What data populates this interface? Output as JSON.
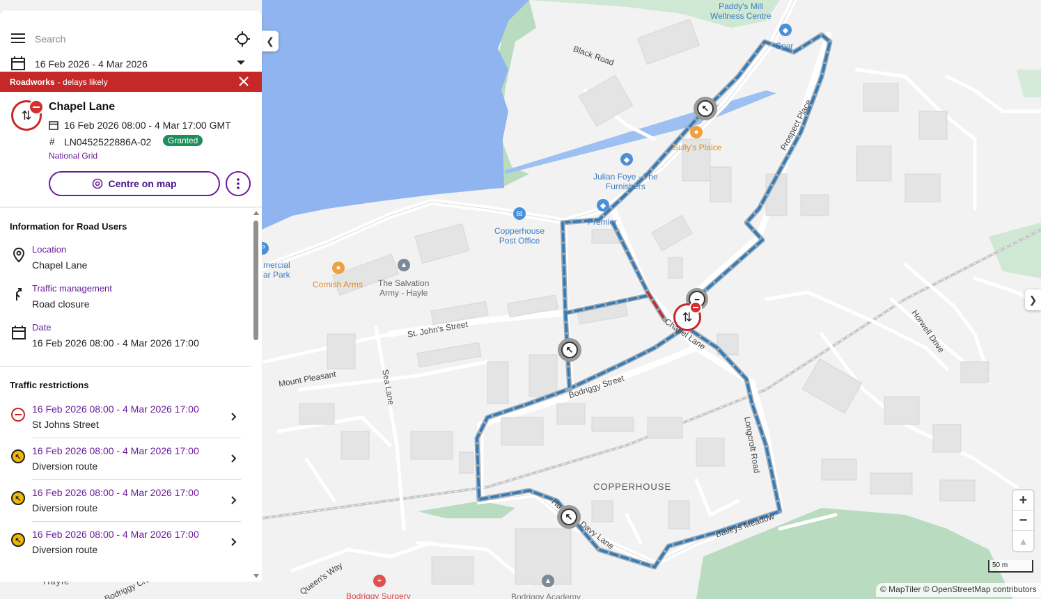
{
  "search": {
    "placeholder": "Search"
  },
  "date_filter": {
    "range": "16 Feb 2026 - 4 Mar 2026"
  },
  "alert": {
    "title": "Roadworks",
    "subtitle": "- delays likely"
  },
  "works": {
    "title": "Chapel Lane",
    "dates": "16 Feb 2026 08:00 - 4 Mar 17:00 GMT",
    "reference": "LN0452522886A-02",
    "status": "Granted",
    "organisation": "National Grid",
    "centre_button": "Centre on map"
  },
  "info": {
    "heading": "Information for Road Users",
    "items": [
      {
        "label": "Location",
        "value": "Chapel Lane",
        "icon": "location-pin-icon"
      },
      {
        "label": "Traffic management",
        "value": "Road closure",
        "icon": "traffic-management-icon"
      },
      {
        "label": "Date",
        "value": "16 Feb 2026 08:00 - 4 Mar 2026 17:00",
        "icon": "calendar-icon"
      }
    ]
  },
  "restrictions": {
    "heading": "Traffic restrictions",
    "items": [
      {
        "dates": "16 Feb 2026 08:00 - 4 Mar 2026 17:00",
        "name": "St Johns Street",
        "type": "closure"
      },
      {
        "dates": "16 Feb 2026 08:00 - 4 Mar 2026 17:00",
        "name": "Diversion route",
        "type": "diversion"
      },
      {
        "dates": "16 Feb 2026 08:00 - 4 Mar 2026 17:00",
        "name": "Diversion route",
        "type": "diversion"
      },
      {
        "dates": "16 Feb 2026 08:00 - 4 Mar 2026 17:00",
        "name": "Diversion route",
        "type": "diversion"
      }
    ]
  },
  "map": {
    "labels": {
      "paddys_mill": "Paddy's Mill\nWellness Centre",
      "spar": "Spar",
      "black_road": "Black Road",
      "sullys": "Sully's Plaice",
      "julian_foye": "Julian Foye - The\nFurnishers",
      "premier": "Premier",
      "post_office": "Copperhouse\nPost Office",
      "prospect_place": "Prospect Place",
      "commercial_car_park": "mercial\nar Park",
      "cornish_arms": "Cornish Arms",
      "salvation_army": "The Salvation\nArmy - Hayle",
      "st_johns_street": "St. John's Street",
      "chapel_lane": "Chapel Lane",
      "mount_pleasant": "Mount Pleasant",
      "sea_lane": "Sea Lane",
      "bodriggy_street": "Bodriggy Street",
      "horwell_drive": "Horwell Drive",
      "longcroft_road": "Longcroft Road",
      "copperhouse": "COPPERHOUSE",
      "baileys_meadow": "Baileys Meadow",
      "humphry_davy_lane": "Humphry Davy Lane",
      "queens_way": "Queen's Way",
      "bodriggy_cres": "Bodriggy Cres",
      "hayle": "Hayle",
      "bodriggy_surgery": "Bodriggy Surgery",
      "bodriggy_academy": "Bodriggy Academy"
    },
    "scale": "50 m",
    "attribution": "© MapTiler © OpenStreetMap contributors"
  },
  "colors": {
    "accent_purple": "#6a1b9a",
    "alert_red": "#c62828",
    "status_green": "#1e8f5a",
    "water": "#8fb4f0",
    "park": "#b9dcc0",
    "diversion_blue": "#2f7ab8"
  }
}
